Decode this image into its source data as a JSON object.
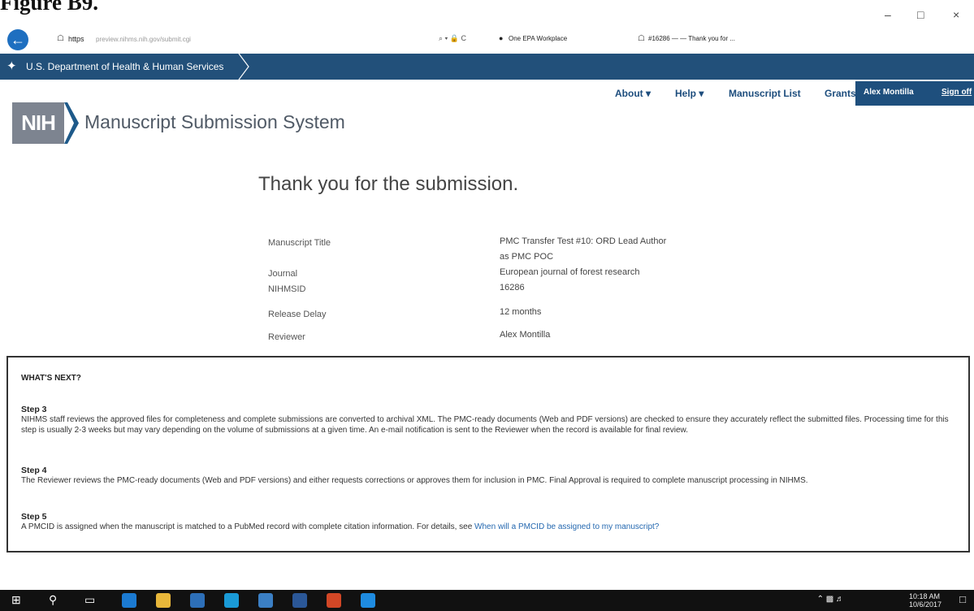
{
  "figure_label": "Figure B9.",
  "browser": {
    "url_scheme": "https",
    "url_rest": "preview.nihms.nih.gov/submit.cgi",
    "search_controls": "⌕ ▾ 🔒 C",
    "workplace": "One EPA Workplace",
    "tab_title": "#16286 — — Thank you for ..."
  },
  "hhs_bar": {
    "label": "U.S. Department of Health & Human Services"
  },
  "nav": {
    "about": "About ▾",
    "help": "Help ▾",
    "manuscript_list": "Manuscript List",
    "grants_reporting": "Grants Reporting",
    "user_name": "Alex Montilla",
    "sign_off": "Sign off"
  },
  "logo": {
    "text": "NIH",
    "title": "Manuscript Submission System"
  },
  "main": {
    "heading": "Thank you for the submission.",
    "details": {
      "manuscript_title_label": "Manuscript Title",
      "manuscript_title_line1": "PMC Transfer Test #10: ORD Lead Author",
      "manuscript_title_line2": "as PMC POC",
      "journal_label": "Journal",
      "journal_value": "European journal of forest research",
      "nihmsid_label": "NIHMSID",
      "nihmsid_value": "16286",
      "release_delay_label": "Release Delay",
      "release_delay_value": "12 months",
      "reviewer_label": "Reviewer",
      "reviewer_value": "Alex Montilla"
    }
  },
  "whats_next": {
    "heading": "WHAT'S NEXT?",
    "step3_title": "Step 3",
    "step3_text": "NIHMS staff reviews the approved files for completeness and complete submissions are converted to archival XML. The PMC-ready documents (Web and PDF versions) are checked to ensure they accurately reflect the submitted files. Processing time for this step is usually 2-3 weeks but may vary depending on the volume of submissions at a given time. An e-mail notification is sent to the Reviewer when the record is available for final review.",
    "step4_title": "Step 4",
    "step4_text": "The Reviewer reviews the PMC-ready documents (Web and PDF versions) and either requests corrections or approves them for inclusion in PMC. Final Approval is required to complete manuscript processing in NIHMS.",
    "step5_title": "Step 5",
    "step5_text": "A PMCID is assigned when the manuscript is matched to a PubMed record with complete citation information. For details, see",
    "step5_link": "When will a PMCID be assigned to my manuscript?"
  },
  "taskbar": {
    "time": "10:18 AM",
    "date": "10/6/2017"
  },
  "colors": {
    "hhs_bar": "#22507a",
    "nav_text": "#1d4d7d",
    "link": "#2468b0",
    "back_button": "#1e6fc0"
  }
}
